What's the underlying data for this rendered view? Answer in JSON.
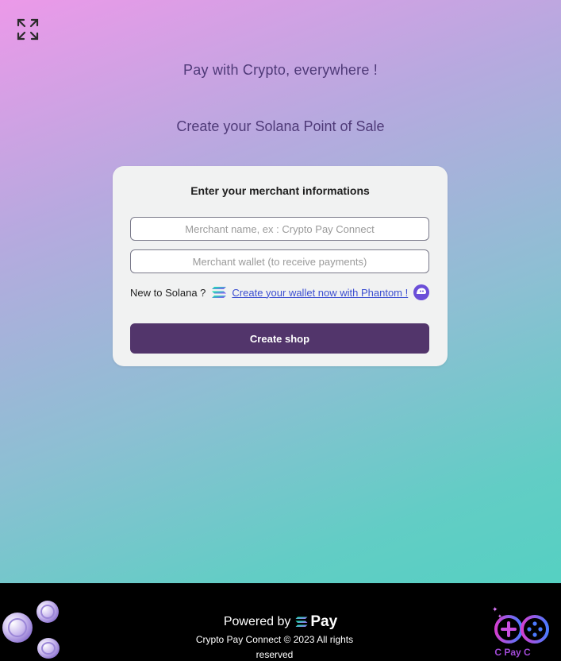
{
  "header": {
    "expand_icon": "expand-arrows-icon",
    "tagline": "Pay with Crypto, everywhere !",
    "subtitle": "Create your Solana Point of Sale"
  },
  "form": {
    "title": "Enter your merchant informations",
    "merchant_name_placeholder": "Merchant name, ex : Crypto Pay Connect",
    "merchant_name_value": "",
    "merchant_wallet_placeholder": "Merchant wallet (to receive payments)",
    "merchant_wallet_value": "",
    "new_to_solana": "New to Solana ?",
    "phantom_link": "Create your wallet now with Phantom !",
    "submit_label": "Create shop"
  },
  "footer": {
    "powered_by": "Powered by",
    "pay_word": "Pay",
    "copyright": "Crypto Pay Connect © 2023 All rights reserved",
    "brand_name": "C Pay C"
  },
  "colors": {
    "accent": "#52356b",
    "heading": "#4f3a78",
    "link": "#3c4fd1",
    "footer_bg": "#000000"
  }
}
